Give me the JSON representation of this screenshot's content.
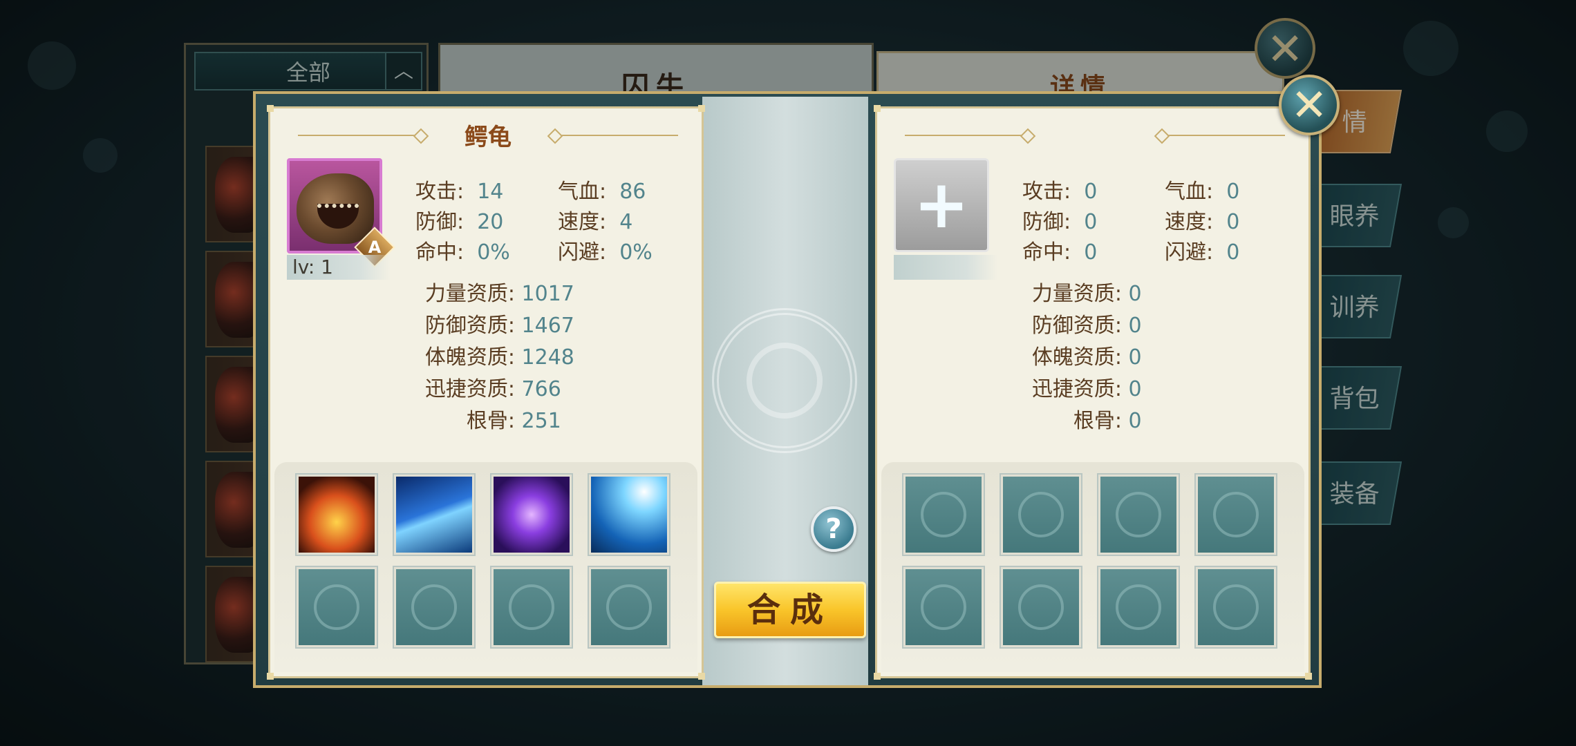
{
  "background": {
    "filter_label": "全部",
    "middle_title": "囚牛",
    "right_title": "详情",
    "tabs": [
      "情",
      "眼养",
      "训养",
      "背包",
      "装备"
    ]
  },
  "left_pet": {
    "name": "鳄龟",
    "grade": "A",
    "level": "lv: 1",
    "stats": [
      {
        "label": "攻击:",
        "value": "14"
      },
      {
        "label": "气血:",
        "value": "86"
      },
      {
        "label": "防御:",
        "value": "20"
      },
      {
        "label": "速度:",
        "value": "4"
      },
      {
        "label": "命中:",
        "value": "0%"
      },
      {
        "label": "闪避:",
        "value": "0%"
      }
    ],
    "aptitudes": [
      {
        "label": "力量资质:",
        "value": "1017"
      },
      {
        "label": "防御资质:",
        "value": "1467"
      },
      {
        "label": "体魄资质:",
        "value": "1248"
      },
      {
        "label": "迅捷资质:",
        "value": "766"
      },
      {
        "label": "根骨:",
        "value": "251"
      }
    ],
    "skills": [
      "fire-shell-skill-icon",
      "ice-spikes-skill-icon",
      "purple-vortex-skill-icon",
      "lightning-skill-icon",
      "empty",
      "empty",
      "empty",
      "empty"
    ]
  },
  "right_pet": {
    "add_symbol": "+",
    "stats": [
      {
        "label": "攻击:",
        "value": "0"
      },
      {
        "label": "气血:",
        "value": "0"
      },
      {
        "label": "防御:",
        "value": "0"
      },
      {
        "label": "速度:",
        "value": "0"
      },
      {
        "label": "命中:",
        "value": "0"
      },
      {
        "label": "闪避:",
        "value": "0"
      }
    ],
    "aptitudes": [
      {
        "label": "力量资质:",
        "value": "0"
      },
      {
        "label": "防御资质:",
        "value": "0"
      },
      {
        "label": "体魄资质:",
        "value": "0"
      },
      {
        "label": "迅捷资质:",
        "value": "0"
      },
      {
        "label": "根骨:",
        "value": "0"
      }
    ]
  },
  "actions": {
    "help": "?",
    "merge": "合成",
    "close": "✕"
  },
  "colors": {
    "stat_label": "#5a3d22",
    "stat_value": "#52848c",
    "title": "#8b4a1a",
    "merge_button": "#f9c52a"
  }
}
